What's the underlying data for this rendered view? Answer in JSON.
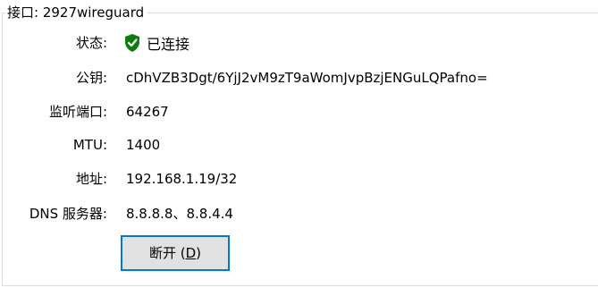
{
  "group": {
    "title": "接口: 2927wireguard"
  },
  "fields": {
    "status": {
      "label": "状态:",
      "value": "已连接",
      "icon": "shield-check-icon",
      "icon_color": "#107c10"
    },
    "public_key": {
      "label": "公钥:",
      "value": "cDhVZB3Dgt/6YjJ2vM9zT9aWomJvpBzjENGuLQPafno="
    },
    "listen_port": {
      "label": "监听端口:",
      "value": "64267"
    },
    "mtu": {
      "label": "MTU:",
      "value": "1400"
    },
    "address": {
      "label": "地址:",
      "value": "192.168.1.19/32"
    },
    "dns": {
      "label": "DNS 服务器:",
      "value": "8.8.8.8、8.8.4.4"
    }
  },
  "button": {
    "label_prefix": "断开 (",
    "accelerator": "D",
    "label_suffix": ")",
    "border_color": "#0078d7"
  }
}
